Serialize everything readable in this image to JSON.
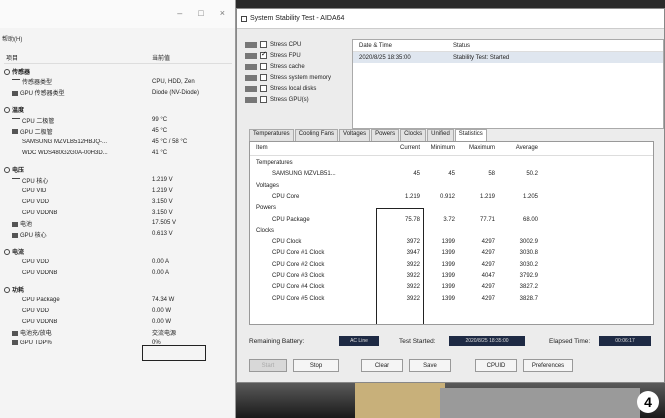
{
  "left_window": {
    "menu": "帮助(H)",
    "columns": {
      "item": "项目",
      "value": "当前值"
    },
    "rows": [
      {
        "label": "传感器",
        "value": "",
        "indent": 0,
        "group": true,
        "icon": "sensor-icon"
      },
      {
        "label": "传感器类型",
        "value": "CPU, HDD, Zen",
        "indent": 1,
        "icon": "sensor-icon"
      },
      {
        "label": "GPU 传感器类型",
        "value": "Diode (NV-Diode)",
        "indent": 1,
        "icon": "gpu-icon"
      },
      {
        "label": "温度",
        "value": "",
        "indent": 0,
        "group": true,
        "icon": "thermometer-icon"
      },
      {
        "label": "CPU 二极管",
        "value": "99 °C",
        "indent": 1,
        "icon": "cpu-icon"
      },
      {
        "label": "GPU 二极管",
        "value": "45 °C",
        "indent": 1,
        "icon": "gpu-icon"
      },
      {
        "label": "SAMSUNG MZVLB512HBJQ-...",
        "value": "45 °C / 58 °C",
        "indent": 1,
        "icon": "disk-icon"
      },
      {
        "label": "WDC WDS480G2G0A-00H3D...",
        "value": "41 °C",
        "indent": 1,
        "icon": "disk-icon"
      },
      {
        "label": "电压",
        "value": "",
        "indent": 0,
        "group": true,
        "icon": "voltage-icon"
      },
      {
        "label": "CPU 核心",
        "value": "1.219 V",
        "indent": 1,
        "icon": "cpu-icon"
      },
      {
        "label": "CPU VID",
        "value": "1.219 V",
        "indent": 1,
        "icon": "cpu-icon"
      },
      {
        "label": "CPU VDD",
        "value": "3.150 V",
        "indent": 1,
        "icon": "cpu-icon"
      },
      {
        "label": "CPU VDDNB",
        "value": "3.150 V",
        "indent": 1,
        "icon": "cpu-icon"
      },
      {
        "label": "电池",
        "value": "17.505 V",
        "indent": 1,
        "icon": "battery-icon"
      },
      {
        "label": "GPU 核心",
        "value": "0.613 V",
        "indent": 1,
        "icon": "gpu-icon"
      },
      {
        "label": "电流",
        "value": "",
        "indent": 0,
        "group": true,
        "icon": "current-icon"
      },
      {
        "label": "CPU VDD",
        "value": "0.00 A",
        "indent": 1,
        "icon": "cpu-icon"
      },
      {
        "label": "CPU VDDNB",
        "value": "0.00 A",
        "indent": 1,
        "icon": "cpu-icon"
      },
      {
        "label": "功耗",
        "value": "",
        "indent": 0,
        "group": true,
        "icon": "power-icon"
      },
      {
        "label": "CPU Package",
        "value": "74.34 W",
        "indent": 1,
        "icon": "cpu-icon"
      },
      {
        "label": "CPU VDD",
        "value": "0.00 W",
        "indent": 1,
        "icon": "cpu-icon"
      },
      {
        "label": "CPU VDDNB",
        "value": "0.00 W",
        "indent": 1,
        "icon": "cpu-icon"
      },
      {
        "label": "电池充/放电",
        "value": "交流电源",
        "indent": 1,
        "icon": "battery-icon"
      },
      {
        "label": "GPU TDP%",
        "value": "0%",
        "indent": 1,
        "icon": "gpu-icon"
      }
    ]
  },
  "right_window": {
    "title": "System Stability Test - AIDA64",
    "stress_options": [
      {
        "label": "Stress CPU",
        "checked": false,
        "icon": "cpu-icon"
      },
      {
        "label": "Stress FPU",
        "checked": true,
        "icon": "fpu-icon"
      },
      {
        "label": "Stress cache",
        "checked": false,
        "icon": "cache-icon"
      },
      {
        "label": "Stress system memory",
        "checked": false,
        "icon": "memory-icon"
      },
      {
        "label": "Stress local disks",
        "checked": false,
        "icon": "disk-icon"
      },
      {
        "label": "Stress GPU(s)",
        "checked": false,
        "icon": "gpu-icon"
      }
    ],
    "status_box": {
      "col_date": "Date & Time",
      "col_status": "Status",
      "row_date": "2020/8/25 18:35:00",
      "row_status": "Stability Test: Started"
    },
    "tabs": [
      "Temperatures",
      "Cooling Fans",
      "Voltages",
      "Powers",
      "Clocks",
      "Unified",
      "Statistics"
    ],
    "active_tab": "Statistics",
    "stats_columns": {
      "item": "Item",
      "current": "Current",
      "minimum": "Minimum",
      "maximum": "Maximum",
      "average": "Average"
    },
    "stats_rows": [
      {
        "item": "Temperatures",
        "current": "",
        "minimum": "",
        "maximum": "",
        "average": "",
        "group": true
      },
      {
        "item": "SAMSUNG MZVLB51...",
        "current": "45",
        "minimum": "45",
        "maximum": "58",
        "average": "50.2"
      },
      {
        "item": "Voltages",
        "current": "",
        "minimum": "",
        "maximum": "",
        "average": "",
        "group": true
      },
      {
        "item": "CPU Core",
        "current": "1.219",
        "minimum": "0.912",
        "maximum": "1.219",
        "average": "1.205"
      },
      {
        "item": "Powers",
        "current": "",
        "minimum": "",
        "maximum": "",
        "average": "",
        "group": true
      },
      {
        "item": "CPU Package",
        "current": "75.78",
        "minimum": "3.72",
        "maximum": "77.71",
        "average": "68.00"
      },
      {
        "item": "Clocks",
        "current": "",
        "minimum": "",
        "maximum": "",
        "average": "",
        "group": true
      },
      {
        "item": "CPU Clock",
        "current": "3972",
        "minimum": "1399",
        "maximum": "4297",
        "average": "3002.9"
      },
      {
        "item": "CPU Core #1 Clock",
        "current": "3947",
        "minimum": "1399",
        "maximum": "4297",
        "average": "3030.8"
      },
      {
        "item": "CPU Core #2 Clock",
        "current": "3922",
        "minimum": "1399",
        "maximum": "4297",
        "average": "3030.2"
      },
      {
        "item": "CPU Core #3 Clock",
        "current": "3922",
        "minimum": "1399",
        "maximum": "4047",
        "average": "3792.9"
      },
      {
        "item": "CPU Core #4 Clock",
        "current": "3922",
        "minimum": "1399",
        "maximum": "4297",
        "average": "3827.2"
      },
      {
        "item": "CPU Core #5 Clock",
        "current": "3922",
        "minimum": "1399",
        "maximum": "4297",
        "average": "3828.7"
      }
    ],
    "footer": {
      "remaining_label": "Remaining Battery:",
      "remaining_value": "AC Line",
      "started_label": "Test Started:",
      "started_value": "2020/8/25 18:35:00",
      "elapsed_label": "Elapsed Time:",
      "elapsed_value": "00:06:17"
    },
    "buttons": {
      "start": "Start",
      "stop": "Stop",
      "clear": "Clear",
      "save": "Save",
      "cpuid": "CPUID",
      "preferences": "Preferences"
    }
  },
  "corner_label": "4"
}
